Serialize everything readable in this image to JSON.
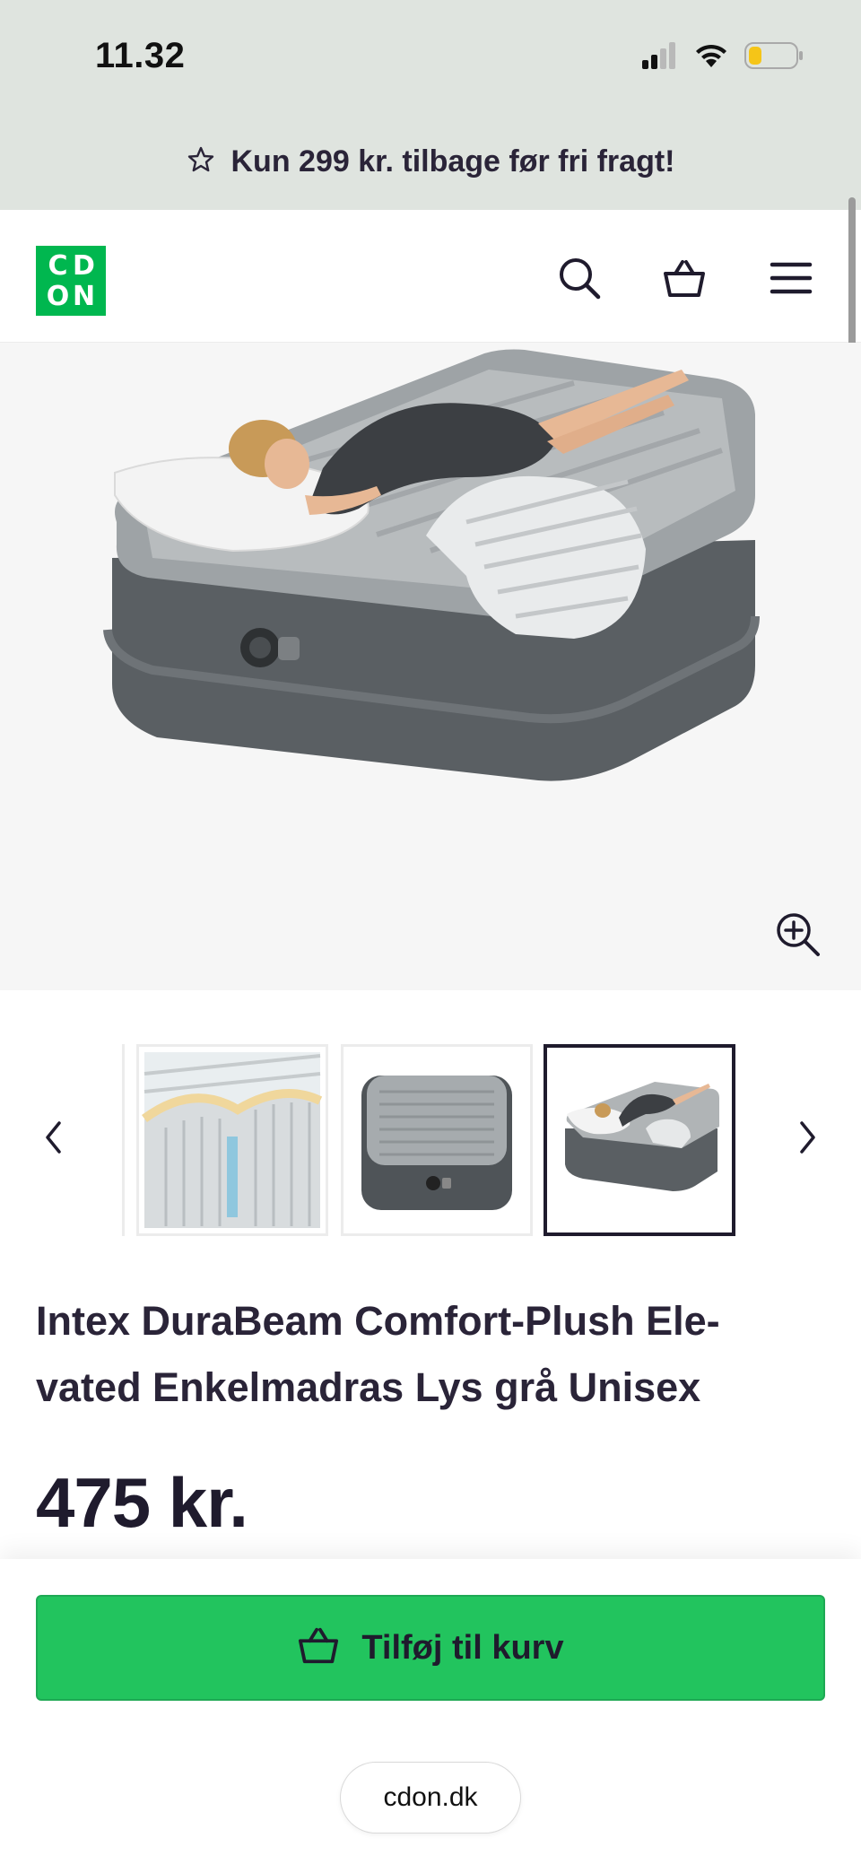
{
  "status_bar": {
    "time": "11.32",
    "icons": [
      "cellular-signal-icon",
      "wifi-icon",
      "battery-low-icon"
    ]
  },
  "promo": {
    "icon": "star-outline-icon",
    "text": "Kun 299 kr. tilbage før fri fragt!"
  },
  "header": {
    "logo_letters": [
      "C",
      "D",
      "O",
      "N"
    ],
    "brand_color": "#00b74f",
    "icons": [
      "search-icon",
      "basket-icon",
      "menu-icon"
    ]
  },
  "gallery": {
    "zoom_icon": "zoom-in-icon",
    "thumbnails": [
      "thumbnail-mattress-cross-section",
      "thumbnail-mattress-front",
      "thumbnail-mattress-with-person"
    ],
    "active_thumbnail_index": 2,
    "prev_icon": "chevron-left-icon",
    "next_icon": "chevron-right-icon"
  },
  "product": {
    "title_line1": "Intex DuraBeam Comfort-Plush Ele-",
    "title_line2": "vated Enkelmadras Lys grå Unisex",
    "price": "475 kr."
  },
  "cart": {
    "button_label": "Tilføj til kurv",
    "button_color": "#22c45e",
    "icon": "basket-icon"
  },
  "browser": {
    "url": "cdon.dk"
  }
}
